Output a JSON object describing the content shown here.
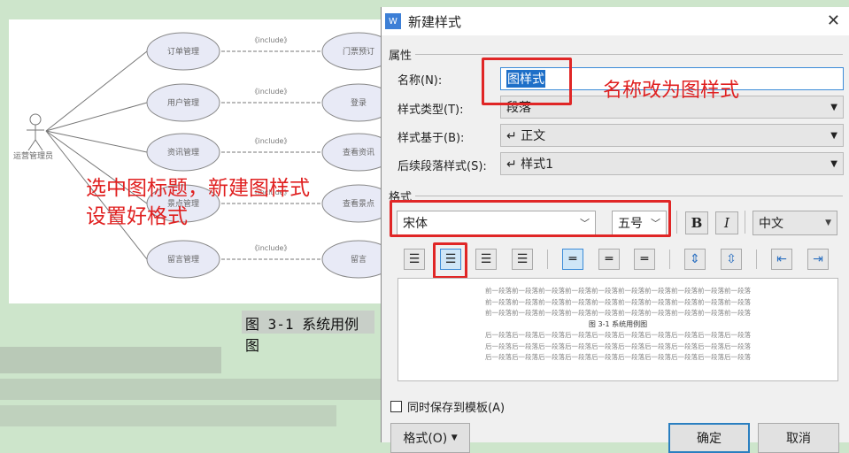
{
  "document": {
    "diagram": {
      "actor": "运营管理员",
      "use_cases": [
        "订单管理",
        "用户管理",
        "资讯管理",
        "景点管理",
        "留言管理"
      ],
      "included": [
        "门票预订",
        "登录",
        "查看资讯",
        "查看景点",
        "留言"
      ],
      "relation": "《include》"
    },
    "caption": "图 3-1 系统用例图",
    "annotation_line1": "选中图标题，新建图样式",
    "annotation_line2": "设置好格式"
  },
  "dialog": {
    "title": "新建样式",
    "app_icon": "W",
    "properties_group": "属性",
    "name_label": "名称(N):",
    "name_value": "图样式",
    "name_annotation": "名称改为图样式",
    "type_label": "样式类型(T):",
    "type_value": "段落",
    "based_on_label": "样式基于(B):",
    "based_on_value": "↵ 正文",
    "next_label": "后续段落样式(S):",
    "next_value": "↵ 样式1",
    "format_group": "格式",
    "font": "宋体",
    "size": "五号",
    "bold": "B",
    "italic": "I",
    "script": "中文",
    "preview_before": "前一段落前一段落前一段落前一段落前一段落前一段落前一段落前一段落前一段落前一段落",
    "preview_caption": "图 3-1 系统用例图",
    "preview_after": "后一段落后一段落后一段落后一段落后一段落后一段落后一段落后一段落后一段落后一段落",
    "save_template": "同时保存到模板(A)",
    "format_button": "格式(O)",
    "ok": "确定",
    "cancel": "取消",
    "highlight_color": "#e02626"
  }
}
